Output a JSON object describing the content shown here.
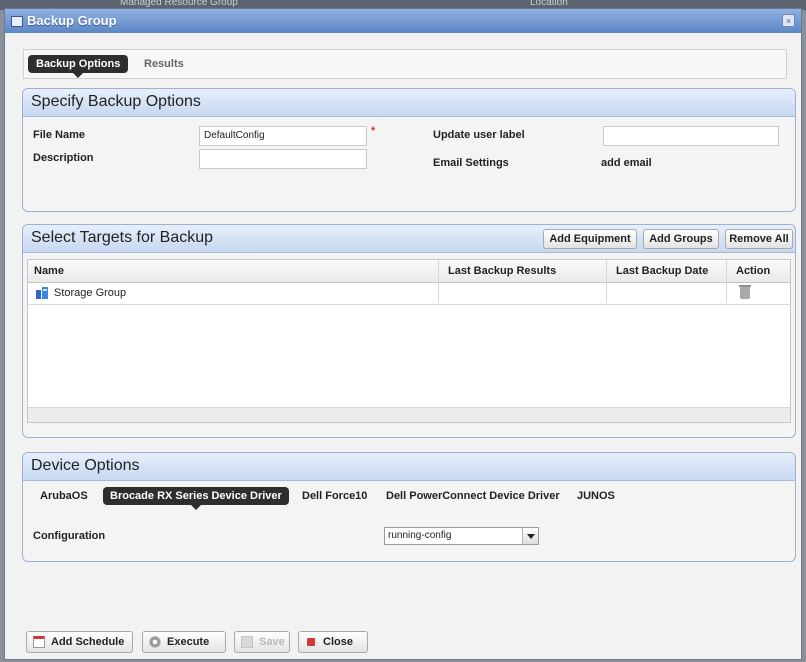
{
  "background_strip": {
    "text1": "Managed Resource Group",
    "text2": "Location"
  },
  "dialog": {
    "title": "Backup Group",
    "close_glyph": "×"
  },
  "tabs": [
    {
      "label": "Backup Options",
      "active": true
    },
    {
      "label": "Results",
      "active": false
    }
  ],
  "backup_options": {
    "title": "Specify Backup Options",
    "file_name_label": "File Name",
    "file_name_value": "DefaultConfig",
    "required_mark": "*",
    "description_label": "Description",
    "description_value": "",
    "update_user_label": "Update user label",
    "update_user_value": "",
    "email_settings_label": "Email Settings",
    "add_email_link": "add email"
  },
  "targets": {
    "title": "Select Targets for Backup",
    "buttons": {
      "add_equipment": "Add Equipment",
      "add_groups": "Add Groups",
      "remove_all": "Remove All"
    },
    "columns": [
      "Name",
      "Last Backup Results",
      "Last Backup Date",
      "Action"
    ],
    "rows": [
      {
        "name": "Storage Group",
        "last_backup_results": "",
        "last_backup_date": "",
        "action_icon": "trash-icon"
      }
    ]
  },
  "device_options": {
    "title": "Device Options",
    "tabs": [
      {
        "label": "ArubaOS",
        "active": false
      },
      {
        "label": "Brocade RX Series Device Driver",
        "active": true
      },
      {
        "label": "Dell Force10",
        "active": false
      },
      {
        "label": "Dell PowerConnect Device Driver",
        "active": false
      },
      {
        "label": "JUNOS",
        "active": false
      }
    ],
    "configuration_label": "Configuration",
    "configuration_value": "running-config"
  },
  "footer": {
    "add_schedule": "Add Schedule",
    "execute": "Execute",
    "save": "Save",
    "close": "Close"
  },
  "colors": {
    "titlebar": "#6f95d3",
    "panel_header": "#d3e1f5",
    "active_tab": "#2e2e2e",
    "required": "#d23a3a"
  }
}
